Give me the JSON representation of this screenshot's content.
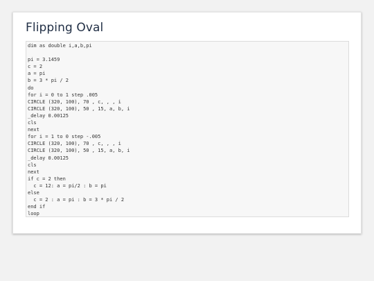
{
  "page": {
    "title": "Flipping Oval"
  },
  "code": {
    "lines": [
      "dim as double i,a,b,pi",
      "",
      "pi = 3.1459",
      "c = 2",
      "a = pi",
      "b = 3 * pi / 2",
      "do",
      "for i = 0 to 1 step .005",
      "CIRCLE (320, 100), 70 , c, , , i",
      "CIRCLE (320, 100), 50 , 15, a, b, i",
      "_delay 0.00125",
      "cls",
      "next",
      "for i = 1 to 0 step -.005",
      "CIRCLE (320, 100), 70 , c, , , i",
      "CIRCLE (320, 100), 50 , 15, a, b, i",
      "_delay 0.00125",
      "cls",
      "next",
      "if c = 2 then",
      "  c = 12: a = pi/2 : b = pi",
      "else",
      "  c = 2 : a = pi : b = 3 * pi / 2",
      "end if",
      "loop"
    ]
  }
}
